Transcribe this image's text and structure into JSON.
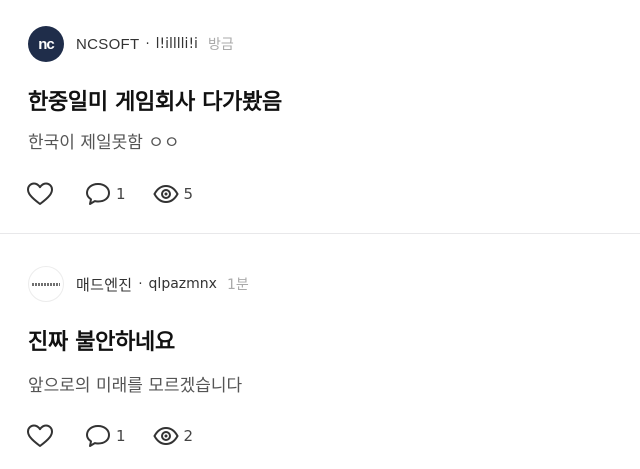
{
  "posts": [
    {
      "avatar_icon": "nc-logo",
      "avatar_text": "nc",
      "company": "NCSOFT",
      "separator": "·",
      "nickname": "l!illlli!i",
      "time": "방금",
      "title": "한중일미 게임회사 다가봤음",
      "body": "한국이 제일못함 ㅇㅇ",
      "actions": {
        "likes": "",
        "comments": "1",
        "views": "5"
      }
    },
    {
      "avatar_icon": "madengine-logo",
      "company": "매드엔진",
      "separator": "·",
      "nickname": "qlpazmnx",
      "time": "1분",
      "title": "진짜 불안하네요",
      "body": "앞으로의 미래를 모르겠습니다",
      "actions": {
        "likes": "",
        "comments": "1",
        "views": "2"
      }
    }
  ]
}
